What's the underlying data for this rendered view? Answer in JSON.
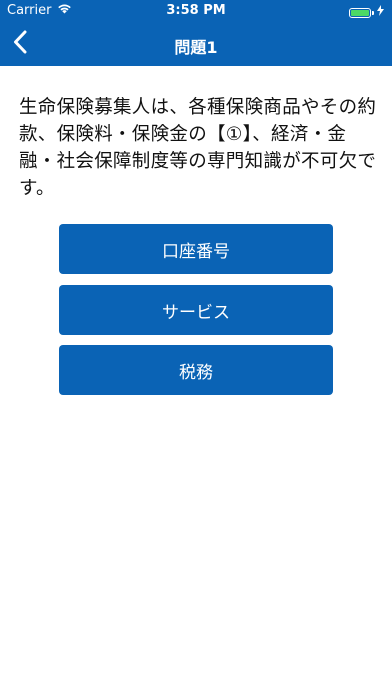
{
  "status_bar": {
    "carrier": "Carrier",
    "time": "3:58 PM",
    "battery_icon": "battery-full-icon",
    "wifi_icon": "wifi-icon",
    "charging_icon": "charging-bolt-icon"
  },
  "nav": {
    "title": "問題1",
    "back_icon": "chevron-left-icon"
  },
  "question": {
    "text": "生命保険募集人は、各種保険商品やその約款、保険料・保険金の【①】、経済・金融・社会保障制度等の専門知識が不可欠です。"
  },
  "answers": [
    {
      "label": "口座番号"
    },
    {
      "label": "サービス"
    },
    {
      "label": "税務"
    }
  ],
  "colors": {
    "accent": "#0a63b5",
    "battery": "#4cd964",
    "text": "#111111",
    "background": "#ffffff"
  }
}
